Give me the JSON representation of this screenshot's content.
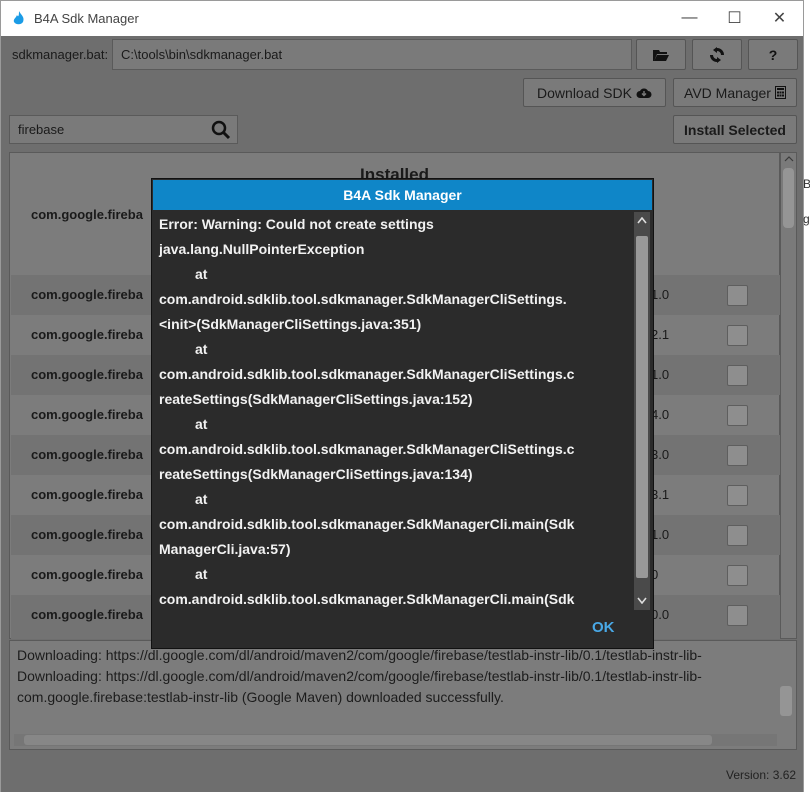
{
  "window": {
    "title": "B4A Sdk Manager",
    "min": "—",
    "max": "☐",
    "close": "✕"
  },
  "path": {
    "label": "sdkmanager.bat:",
    "value": "C:\\tools\\bin\\sdkmanager.bat"
  },
  "toolbar": {
    "folder": "📂",
    "refresh": "⟳",
    "help": "?",
    "download_sdk": "Download SDK",
    "avd_manager": "AVD Manager",
    "install_selected": "Install Selected"
  },
  "search": {
    "value": "firebase"
  },
  "installed": {
    "title": "Installed",
    "rows": [
      {
        "name": "com.google.fireba",
        "version": ""
      },
      {
        "name": "com.google.fireba",
        "version": "1.0"
      },
      {
        "name": "com.google.fireba",
        "version": "2.1"
      },
      {
        "name": "com.google.fireba",
        "version": "1.0"
      },
      {
        "name": "com.google.fireba",
        "version": "4.0"
      },
      {
        "name": "com.google.fireba",
        "version": "3.0"
      },
      {
        "name": "com.google.fireba",
        "version": "3.1"
      },
      {
        "name": "com.google.fireba",
        "version": "1.0"
      },
      {
        "name": "com.google.fireba",
        "version": "0"
      },
      {
        "name": "com.google.fireba",
        "version": "0.0"
      }
    ]
  },
  "log": {
    "lines": [
      "Downloading: https://dl.google.com/dl/android/maven2/com/google/firebase/testlab-instr-lib/0.1/testlab-instr-lib-",
      "Downloading: https://dl.google.com/dl/android/maven2/com/google/firebase/testlab-instr-lib/0.1/testlab-instr-lib-",
      "com.google.firebase:testlab-instr-lib (Google Maven) downloaded successfully."
    ]
  },
  "version": "Version: 3.62",
  "dialog": {
    "title": "B4A Sdk Manager",
    "lines": [
      "Error: Warning: Could not create settings",
      "java.lang.NullPointerException",
      "        at",
      "com.android.sdklib.tool.sdkmanager.SdkManagerCliSettings.",
      "<init>(SdkManagerCliSettings.java:351)",
      "        at",
      "com.android.sdklib.tool.sdkmanager.SdkManagerCliSettings.c",
      "reateSettings(SdkManagerCliSettings.java:152)",
      "        at",
      "com.android.sdklib.tool.sdkmanager.SdkManagerCliSettings.c",
      "reateSettings(SdkManagerCliSettings.java:134)",
      "        at",
      "com.android.sdklib.tool.sdkmanager.SdkManagerCli.main(Sdk",
      "ManagerCli.java:57)",
      "        at",
      "com.android.sdklib.tool.sdkmanager.SdkManagerCli.main(Sdk"
    ],
    "ok": "OK"
  },
  "background_fragments": {
    "right1": "B",
    "right2": "g"
  },
  "colors": {
    "accent": "#0f86c8",
    "ok": "#49a8e6"
  }
}
